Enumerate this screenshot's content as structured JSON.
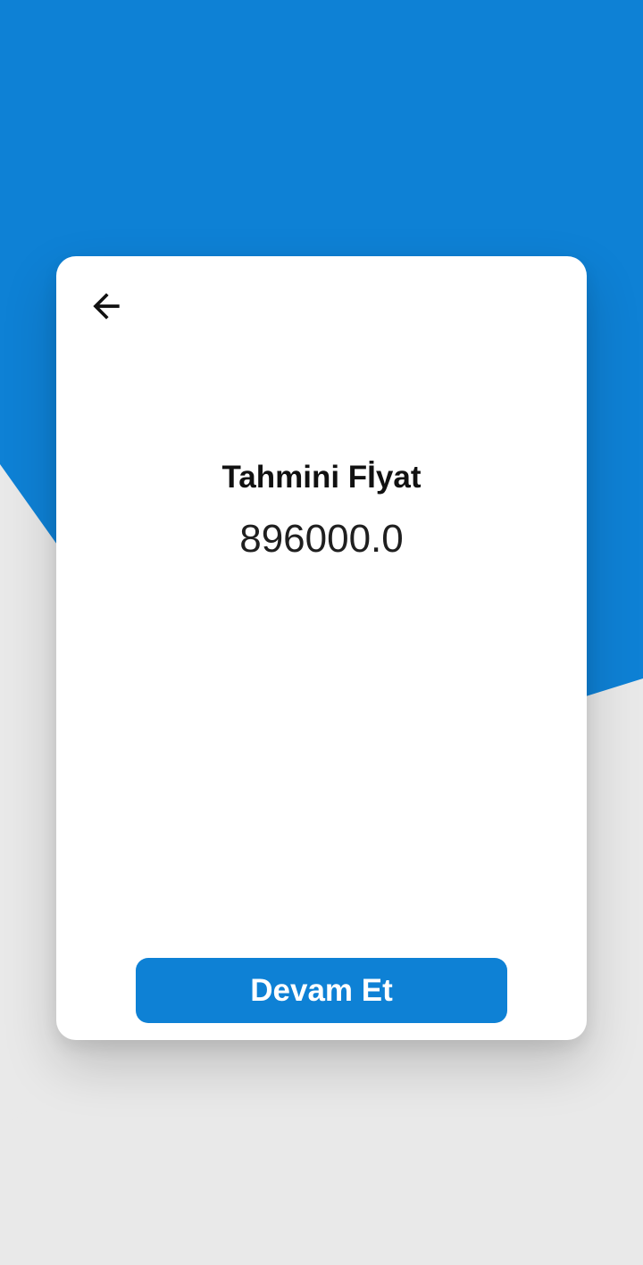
{
  "colors": {
    "primary_blue": "#0e81d5",
    "background_gray": "#e9e9e9",
    "card": "#ffffff"
  },
  "card": {
    "back_icon": "arrow-left-icon",
    "title": "Tahmini Fİyat",
    "value": "896000.0"
  },
  "actions": {
    "continue_label": "Devam Et"
  }
}
